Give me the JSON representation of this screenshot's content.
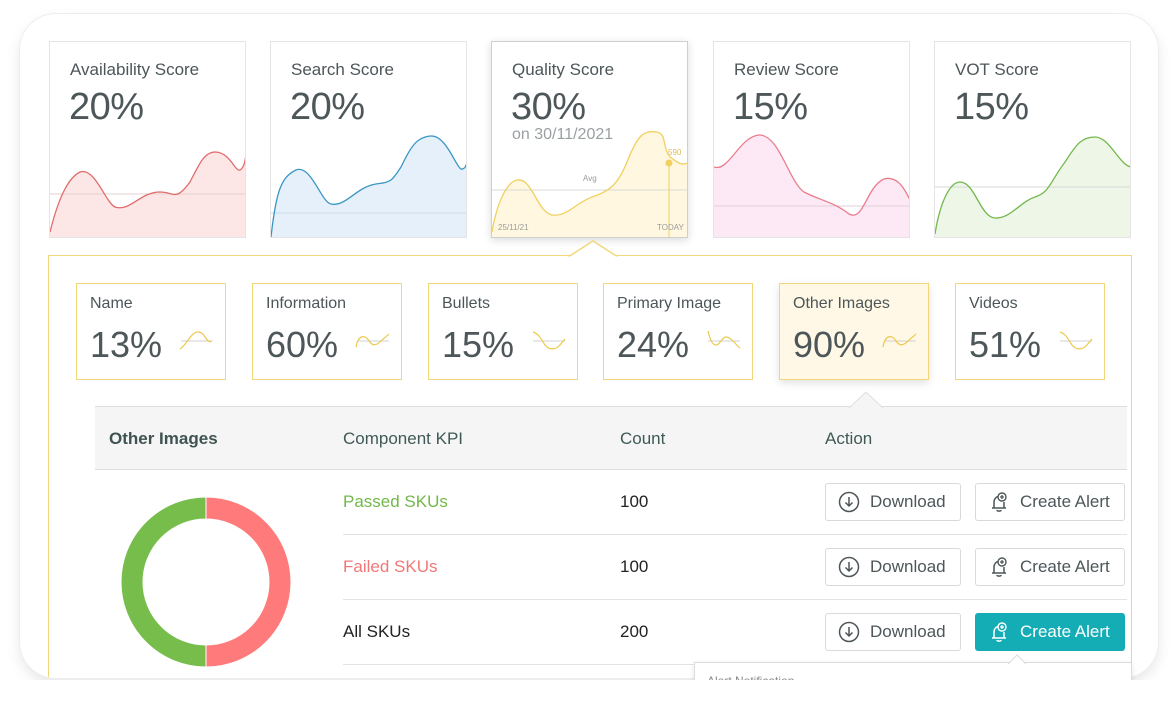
{
  "score_cards": [
    {
      "title": "Availability Score",
      "value": "20%",
      "color": "#e06c6c",
      "fill": "#fde6e6"
    },
    {
      "title": "Search Score",
      "value": "20%",
      "color": "#3a97c4",
      "fill": "#e6f0fb"
    },
    {
      "title": "Quality Score",
      "value": "30%",
      "subtext": "on 30/11/2021",
      "color": "#f0d060",
      "fill": "#fff7e0",
      "chart_labels": {
        "avg": "Avg",
        "start_date": "25/11/21",
        "end_label": "TODAY",
        "point_value": "590"
      }
    },
    {
      "title": "Review Score",
      "value": "15%",
      "color": "#ea7c8c",
      "fill": "#fde9f5"
    },
    {
      "title": "VOT Score",
      "value": "15%",
      "color": "#72b84a",
      "fill": "#eef6e8"
    }
  ],
  "components": [
    {
      "title": "Name",
      "value": "13%"
    },
    {
      "title": "Information",
      "value": "60%"
    },
    {
      "title": "Bullets",
      "value": "15%"
    },
    {
      "title": "Primary Image",
      "value": "24%"
    },
    {
      "title": "Other Images",
      "value": "90%",
      "selected": true
    },
    {
      "title": "Videos",
      "value": "51%"
    }
  ],
  "sparkline_color": "#ecc94b",
  "table": {
    "section_title": "Other Images",
    "headers": {
      "kpi": "Component KPI",
      "count": "Count",
      "action": "Action"
    },
    "rows": [
      {
        "kpi": "Passed SKUs",
        "count": "100",
        "kpi_color": "#72b84a",
        "download_label": "Download",
        "alert_label": "Create Alert"
      },
      {
        "kpi": "Failed SKUs",
        "count": "100",
        "kpi_color": "#f07878",
        "download_label": "Download",
        "alert_label": "Create Alert"
      },
      {
        "kpi": "All SKUs",
        "count": "200",
        "kpi_color": "#222222",
        "download_label": "Download",
        "alert_label": "Create Alert",
        "alert_active": true
      }
    ]
  },
  "donut": {
    "segments": [
      {
        "label": "Passed SKUs",
        "value": 100,
        "color": "#76bd4c"
      },
      {
        "label": "Failed SKUs",
        "value": 100,
        "color": "#ff7a7a"
      }
    ]
  },
  "alert_popup": {
    "title": "Alert Notification"
  },
  "accent_color": "#14adb6"
}
